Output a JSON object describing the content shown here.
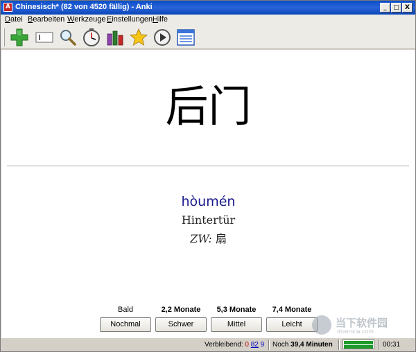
{
  "window": {
    "title": "Chinesisch* (82 von 4520 fällig) - Anki",
    "app_icon_glyph": "A",
    "buttons": {
      "minimize": "_",
      "maximize": "□",
      "close": "X"
    }
  },
  "menubar": {
    "items": [
      {
        "label": "Datei",
        "mnemonic": "D",
        "rest": "atei"
      },
      {
        "label": "Bearbeiten",
        "mnemonic": "B",
        "rest": "earbeiten"
      },
      {
        "label": "Werkzeuge",
        "mnemonic": "W",
        "rest": "erkzeuge"
      },
      {
        "label": "Einstellungen",
        "mnemonic": "E",
        "rest": "instellungen"
      },
      {
        "label": "Hilfe",
        "mnemonic": "H",
        "rest": "ilfe"
      }
    ]
  },
  "toolbar": {
    "icons": [
      "add-icon",
      "edit-field-icon",
      "search-icon",
      "timer-icon",
      "statistics-icon",
      "star-icon",
      "play-icon",
      "list-icon"
    ],
    "colors": {
      "add": "#3aa63a",
      "star": "#f5c518",
      "stats_bars": [
        "#8e44ad",
        "#2e7d32",
        "#c62828"
      ]
    }
  },
  "card": {
    "question": "后门",
    "pinyin": "hòumén",
    "meaning": "Hintertür",
    "zw_label": "ZW:",
    "zw_value": "扇"
  },
  "answer": {
    "intervals": [
      "Bald",
      "2,2 Monate",
      "5,3 Monate",
      "7,4 Monate"
    ],
    "buttons": [
      "Nochmal",
      "Schwer",
      "Mittel",
      "Leicht"
    ]
  },
  "statusbar": {
    "remaining_label": "Verbleibend:",
    "remaining_new": "0",
    "remaining_due": "82",
    "remaining_review": "9",
    "time_prefix": "Noch",
    "time_value": "39,4 Minuten",
    "progress_fraction": 1.0,
    "elapsed": "00:31"
  },
  "watermark": {
    "main": "当下软件园",
    "sub": "downxia.com"
  }
}
